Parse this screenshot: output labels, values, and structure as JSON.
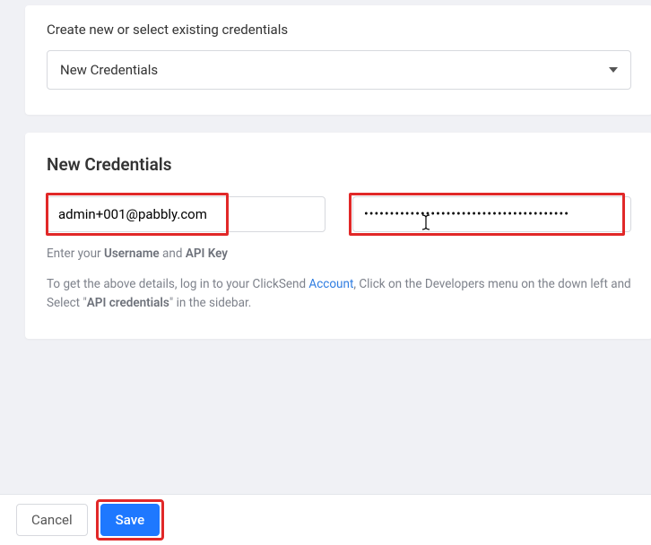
{
  "selector": {
    "title": "Create new or select existing credentials",
    "value": "New Credentials"
  },
  "credentials": {
    "heading": "New Credentials",
    "username": "admin+001@pabbly.com",
    "api_key": "••••••••••••••••••••••••••••••••••••••••",
    "hint_prefix": "Enter your ",
    "hint_b1": "Username",
    "hint_mid": " and ",
    "hint_b2": "API Key",
    "desc_1": "To get the above details, log in to your ClickSend ",
    "desc_link": "Account",
    "desc_2": ", Click on the Developers menu on the down left and Select \"",
    "desc_b": "API credentials",
    "desc_3": "\" in the sidebar."
  },
  "footer": {
    "cancel": "Cancel",
    "save": "Save"
  }
}
